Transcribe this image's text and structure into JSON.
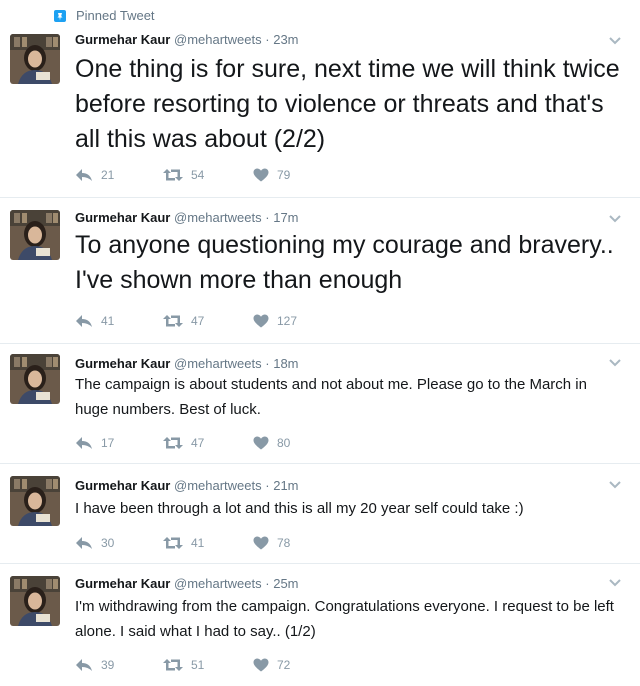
{
  "pinned_label": "Pinned Tweet",
  "tweets": [
    {
      "name": "Gurmehar Kaur",
      "handle": "@mehartweets",
      "separator": "·",
      "time": "23m",
      "text": "One thing is for sure, next time we will think twice before resorting to violence or threats and that's all this was about (2/2)",
      "replies": "21",
      "retweets": "54",
      "likes": "79"
    },
    {
      "name": "Gurmehar Kaur",
      "handle": "@mehartweets",
      "separator": "·",
      "time": "17m",
      "text": "To anyone questioning my courage and bravery.. I've shown more than enough",
      "replies": "41",
      "retweets": "47",
      "likes": "127"
    },
    {
      "name": "Gurmehar Kaur",
      "handle": "@mehartweets",
      "separator": "·",
      "time": "18m",
      "text": "The campaign is about students and not about me. Please go to the March in huge numbers. Best of luck.",
      "replies": "17",
      "retweets": "47",
      "likes": "80"
    },
    {
      "name": "Gurmehar Kaur",
      "handle": "@mehartweets",
      "separator": "·",
      "time": "21m",
      "text": "I have been through a lot and this is all my 20 year self could take :)",
      "replies": "30",
      "retweets": "41",
      "likes": "78"
    },
    {
      "name": "Gurmehar Kaur",
      "handle": "@mehartweets",
      "separator": "·",
      "time": "25m",
      "text": "I'm withdrawing from the campaign. Congratulations everyone. I request to be left alone. I said what I had to say.. (1/2)",
      "replies": "39",
      "retweets": "51",
      "likes": "72"
    }
  ],
  "colors": {
    "accent": "#1da1f2",
    "muted": "#657786",
    "action": "#8899a6",
    "divider": "#e6ecf0"
  },
  "icons": {
    "pin": "pin-icon",
    "reply": "reply-icon",
    "retweet": "retweet-icon",
    "like": "heart-icon",
    "more": "chevron-down-icon"
  }
}
